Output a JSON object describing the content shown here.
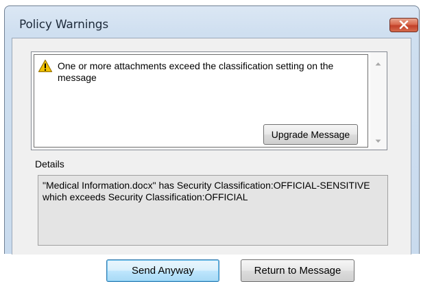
{
  "window": {
    "title": "Policy Warnings"
  },
  "warning": {
    "icon": "warning-triangle-icon",
    "message": "One or more attachments exceed the classification setting on the message",
    "upgrade_label": "Upgrade Message"
  },
  "details": {
    "label": "Details",
    "text": "\"Medical Information.docx\" has Security Classification:OFFICIAL-SENSITIVE which exceeds Security Classification:OFFICIAL"
  },
  "buttons": {
    "send_anyway": "Send Anyway",
    "return_to_message": "Return to Message"
  },
  "colors": {
    "title_bar": "#cfdff0",
    "close_button": "#c2402a",
    "warning_icon": "#f2c200",
    "default_button": "#bee6fd"
  }
}
